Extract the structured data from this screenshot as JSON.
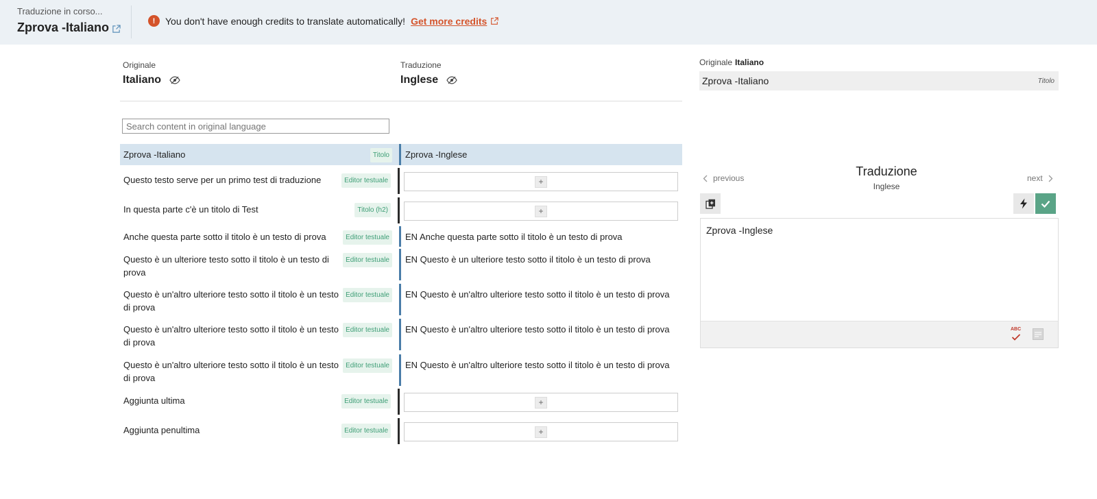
{
  "header": {
    "subtitle": "Traduzione in corso...",
    "title": "Zprova -Italiano",
    "alert_text": "You don't have enough credits to translate automatically!",
    "alert_link": "Get more credits"
  },
  "columns": {
    "original_caption": "Originale",
    "original_lang": "Italiano",
    "translation_caption": "Traduzione",
    "translation_lang": "Inglese"
  },
  "search": {
    "placeholder": "Search content in original language"
  },
  "rows": [
    {
      "source": "Zprova -Italiano",
      "tag": "Titolo",
      "target": "Zprova -Inglese",
      "selected": true
    },
    {
      "source": "Questo testo serve per un primo test di traduzione",
      "tag": "Editor testuale",
      "target": ""
    },
    {
      "source": "In questa parte c'è un titolo di Test",
      "tag": "Titolo (h2)",
      "target": ""
    },
    {
      "source": "Anche questa parte sotto il titolo è un testo di prova",
      "tag": "Editor testuale",
      "target": "EN Anche questa parte sotto il titolo è un testo di prova"
    },
    {
      "source": "Questo è un ulteriore testo sotto il titolo è un testo di prova",
      "tag": "Editor testuale",
      "target": "EN Questo è un ulteriore testo sotto il titolo è un testo di prova"
    },
    {
      "source": "Questo è un'altro ulteriore testo sotto il titolo è un testo di prova",
      "tag": "Editor testuale",
      "target": "EN Questo è un'altro ulteriore testo sotto il titolo è un testo di prova"
    },
    {
      "source": "Questo è un'altro ulteriore testo sotto il titolo è un testo di prova",
      "tag": "Editor testuale",
      "target": "EN Questo è un'altro ulteriore testo sotto il titolo è un testo di prova"
    },
    {
      "source": "Questo è un'altro ulteriore testo sotto il titolo è un testo di prova",
      "tag": "Editor testuale",
      "target": "EN Questo è un'altro ulteriore testo sotto il titolo è un testo di prova"
    },
    {
      "source": "Aggiunta ultima",
      "tag": "Editor testuale",
      "target": ""
    },
    {
      "source": "Aggiunta penultima",
      "tag": "Editor testuale",
      "target": ""
    }
  ],
  "right_panel": {
    "original_caption": "Originale",
    "original_lang": "Italiano",
    "original_text": "Zprova -Italiano",
    "original_tag": "Titolo",
    "previous": "previous",
    "next": "next",
    "translation_title": "Traduzione",
    "translation_lang": "Inglese",
    "editor_text": "Zprova -Inglese",
    "spell_label": "ABC"
  },
  "colors": {
    "accent": "#d4532a",
    "confirm": "#5aa487",
    "selected_row": "#d6e4ef",
    "tag_text": "#3e9e76"
  },
  "icons": [
    "alert-icon",
    "external-link-icon",
    "eye-slash-icon",
    "plus-icon",
    "chevron-left-icon",
    "chevron-right-icon",
    "copy-icon",
    "lightning-icon",
    "check-icon",
    "spellcheck-icon",
    "glossary-icon"
  ]
}
